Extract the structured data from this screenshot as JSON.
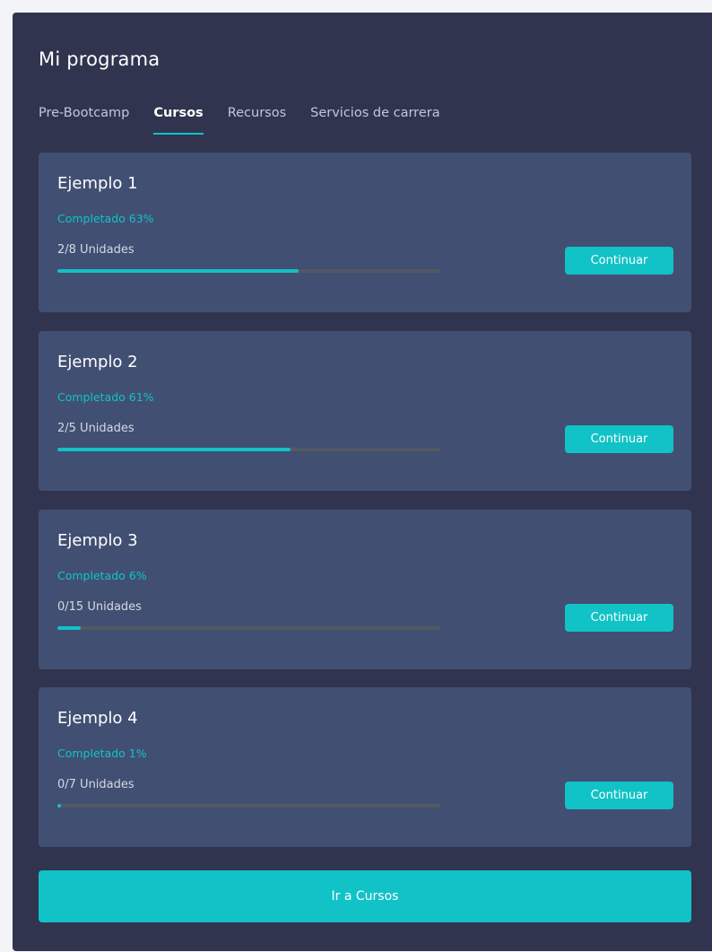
{
  "header": {
    "title": "Mi programa"
  },
  "tabs": [
    {
      "label": "Pre-Bootcamp",
      "active": false
    },
    {
      "label": "Cursos",
      "active": true
    },
    {
      "label": "Recursos",
      "active": false
    },
    {
      "label": "Servicios de carrera",
      "active": false
    }
  ],
  "courses": [
    {
      "name": "Ejemplo 1",
      "completed_label": "Completado 63%",
      "progress": 63,
      "units": "2/8 Unidades",
      "button_label": "Continuar"
    },
    {
      "name": "Ejemplo 2",
      "completed_label": "Completado 61%",
      "progress": 61,
      "units": "2/5 Unidades",
      "button_label": "Continuar"
    },
    {
      "name": "Ejemplo 3",
      "completed_label": "Completado 6%",
      "progress": 6,
      "units": "0/15 Unidades",
      "button_label": "Continuar"
    },
    {
      "name": "Ejemplo 4",
      "completed_label": "Completado 1%",
      "progress": 1,
      "units": "0/7 Unidades",
      "button_label": "Continuar"
    }
  ],
  "footer": {
    "button_label": "Ir a Cursos"
  },
  "colors": {
    "panel_background": "#30344f",
    "card_background": "#414f72",
    "accent": "#11c2c7",
    "progress_track": "#535862"
  }
}
